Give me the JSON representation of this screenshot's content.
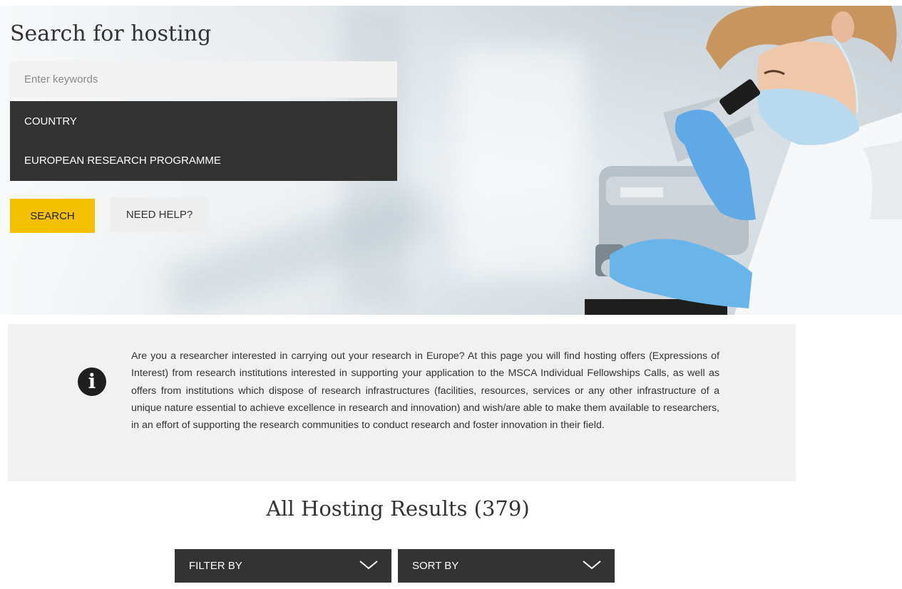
{
  "hero": {
    "title": "Search for hosting",
    "keywords_placeholder": "Enter keywords",
    "filters": [
      "COUNTRY",
      "EUROPEAN RESEARCH PROGRAMME"
    ],
    "search_label": "SEARCH",
    "help_label": "NEED HELP?"
  },
  "info": {
    "text": "Are you a researcher interested in carrying out your research in Europe? At this page you will find hosting offers (Expressions of Interest) from research institutions interested in supporting your application to the MSCA Individual Fellowships Calls, as well as offers from institutions which dispose of research infrastructures (facilities, resources, services or any other infrastructure of a unique nature essential to achieve excellence in research and innovation) and wish/are able to make them available to researchers, in an effort of supporting the research communities to conduct research and foster innovation in their field."
  },
  "results": {
    "title": "All Hosting Results (379)",
    "filter_label": "FILTER BY",
    "sort_label": "SORT BY"
  },
  "colors": {
    "accent": "#f5c000",
    "dark": "#333333",
    "light_grey": "#f1f1f1"
  }
}
